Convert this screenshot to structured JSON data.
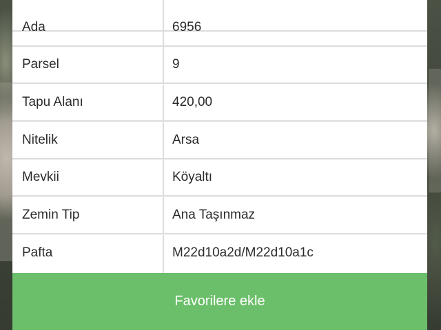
{
  "details": {
    "rows": [
      {
        "label": "",
        "value": ""
      },
      {
        "label": "Ada",
        "value": "6956"
      },
      {
        "label": "Parsel",
        "value": "9"
      },
      {
        "label": "Tapu Alanı",
        "value": "420,00"
      },
      {
        "label": "Nitelik",
        "value": "Arsa"
      },
      {
        "label": "Mevkii",
        "value": "Köyaltı"
      },
      {
        "label": "Zemin Tip",
        "value": "Ana Taşınmaz"
      },
      {
        "label": "Pafta",
        "value": "M22d10a2d/M22d10a1c"
      }
    ]
  },
  "actions": {
    "favorite_label": "Favorilere ekle"
  },
  "colors": {
    "button_green": "#6cbf6a",
    "border_gray": "#dcdcdc"
  }
}
